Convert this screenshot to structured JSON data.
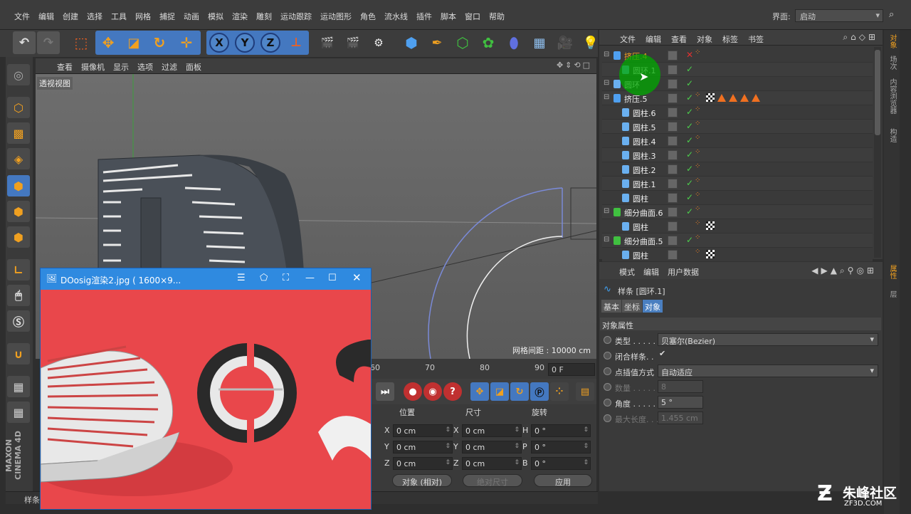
{
  "menubar": {
    "items": [
      "文件",
      "编辑",
      "创建",
      "选择",
      "工具",
      "网格",
      "捕捉",
      "动画",
      "模拟",
      "渲染",
      "雕刻",
      "运动跟踪",
      "运动图形",
      "角色",
      "流水线",
      "插件",
      "脚本",
      "窗口",
      "帮助"
    ],
    "layout_label": "界面:",
    "layout_value": "启动"
  },
  "viewport": {
    "menu": [
      "查看",
      "摄像机",
      "显示",
      "选项",
      "过滤",
      "面板"
    ],
    "view_label": "透视视图",
    "grid_text": "网格间距 : 10000 cm"
  },
  "timeline": {
    "ticks": [
      "60",
      "70",
      "80",
      "90"
    ],
    "frame": "0 F"
  },
  "coords": {
    "headers": [
      "位置",
      "尺寸",
      "旋转"
    ],
    "pos": [
      {
        "axis": "X",
        "value": "0 cm"
      },
      {
        "axis": "Y",
        "value": "0 cm"
      },
      {
        "axis": "Z",
        "value": "0 cm"
      }
    ],
    "size": [
      {
        "axis": "X",
        "value": "0 cm"
      },
      {
        "axis": "Y",
        "value": "0 cm"
      },
      {
        "axis": "Z",
        "value": "0 cm"
      }
    ],
    "rot": [
      {
        "axis": "H",
        "value": "0 °"
      },
      {
        "axis": "P",
        "value": "0 °"
      },
      {
        "axis": "B",
        "value": "0 °"
      }
    ],
    "mode": "对象 (相对)",
    "size_mode": "绝对尺寸",
    "apply": "应用"
  },
  "status": {
    "text": "样条"
  },
  "objmgr": {
    "menu": [
      "文件",
      "编辑",
      "查看",
      "对象",
      "标签",
      "书签"
    ],
    "rows": [
      {
        "name": "挤压.4",
        "indent": 0,
        "icon": "extrude-icon",
        "color": "#f0a020",
        "chk": "✕"
      },
      {
        "name": "圆环.1",
        "indent": 1,
        "icon": "spline-icon",
        "color": "#eee",
        "chk": "✓"
      },
      {
        "name": "圆环",
        "indent": 0,
        "icon": "spline-icon",
        "color": "#eee",
        "chk": "✓"
      },
      {
        "name": "挤压.5",
        "indent": 0,
        "icon": "extrude-icon",
        "color": "#eee",
        "chk": "✓"
      },
      {
        "name": "圆柱.6",
        "indent": 1,
        "icon": "cylinder-icon",
        "color": "#eee",
        "chk": "✓"
      },
      {
        "name": "圆柱.5",
        "indent": 1,
        "icon": "cylinder-icon",
        "color": "#eee",
        "chk": "✓"
      },
      {
        "name": "圆柱.4",
        "indent": 1,
        "icon": "cylinder-icon",
        "color": "#eee",
        "chk": "✓"
      },
      {
        "name": "圆柱.3",
        "indent": 1,
        "icon": "cylinder-icon",
        "color": "#eee",
        "chk": "✓"
      },
      {
        "name": "圆柱.2",
        "indent": 1,
        "icon": "cylinder-icon",
        "color": "#eee",
        "chk": "✓"
      },
      {
        "name": "圆柱.1",
        "indent": 1,
        "icon": "cylinder-icon",
        "color": "#eee",
        "chk": "✓"
      },
      {
        "name": "圆柱",
        "indent": 1,
        "icon": "cylinder-icon",
        "color": "#eee",
        "chk": "✓"
      },
      {
        "name": "细分曲面.6",
        "indent": 0,
        "icon": "subdivision-icon",
        "color": "#eee",
        "chk": "✓"
      },
      {
        "name": "圆柱",
        "indent": 1,
        "icon": "cylinder-icon",
        "color": "#eee",
        "chk": ""
      },
      {
        "name": "细分曲面.5",
        "indent": 0,
        "icon": "subdivision-icon",
        "color": "#eee",
        "chk": "✓"
      },
      {
        "name": "圆柱",
        "indent": 1,
        "icon": "cylinder-icon",
        "color": "#eee",
        "chk": ""
      }
    ]
  },
  "attr": {
    "menu": [
      "模式",
      "编辑",
      "用户数据"
    ],
    "title": "样条 [圆环.1]",
    "tabs": [
      "基本",
      "坐标",
      "对象"
    ],
    "section": "对象属性",
    "props": [
      {
        "label": "类型 . . . . . . .",
        "value": "贝塞尔(Bezier)",
        "type": "dropdown",
        "disabled": false
      },
      {
        "label": "闭合样条. .",
        "value": "✔",
        "type": "check",
        "disabled": false
      },
      {
        "label": "点插值方式",
        "value": "自动适应",
        "type": "dropdown",
        "disabled": false
      },
      {
        "label": "数量 . . . . . .",
        "value": "8",
        "type": "number",
        "disabled": true
      },
      {
        "label": "角度 . . . . . .",
        "value": "5 °",
        "type": "number",
        "disabled": false
      },
      {
        "label": "最大长度. . . .",
        "value": "1.455 cm",
        "type": "number",
        "disabled": true
      }
    ]
  },
  "sidetabs": [
    "对象",
    "场次",
    "内容浏览器",
    "构造",
    "属性",
    "层"
  ],
  "imgwin": {
    "title": "DOosig渲染2.jpg ( 1600×9..."
  },
  "watermark": {
    "brand": "朱峰社区",
    "url": "ZF3D.COM"
  },
  "brand": "MAXON CINEMA 4D"
}
